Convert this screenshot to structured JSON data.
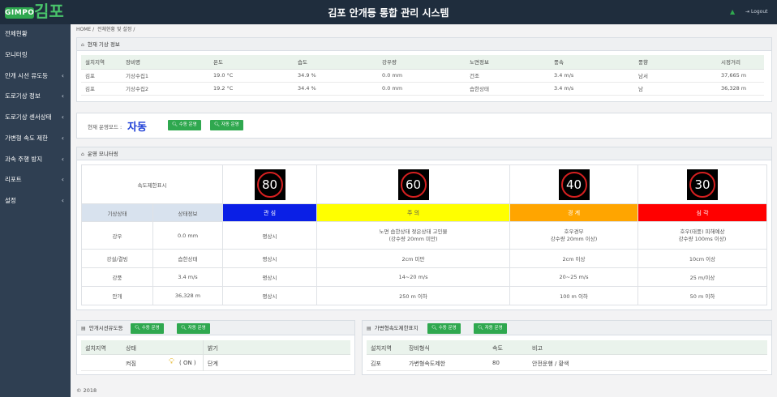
{
  "header": {
    "logo_en": "GIMPO",
    "logo_ko": "김포",
    "title": "김포 안개등 통합 관리 시스템",
    "logout_label": "Logout"
  },
  "sidebar": {
    "items": [
      {
        "label": "전체현황",
        "chevron": false
      },
      {
        "label": "모니터링",
        "chevron": false
      },
      {
        "label": "안개 시선 유도등",
        "chevron": true
      },
      {
        "label": "도로기상 정보",
        "chevron": true
      },
      {
        "label": "도로기상 센서상태",
        "chevron": true
      },
      {
        "label": "가변형 속도 제한",
        "chevron": true
      },
      {
        "label": "과속 주행 방지",
        "chevron": true
      },
      {
        "label": "리포트",
        "chevron": true
      },
      {
        "label": "설정",
        "chevron": true
      }
    ]
  },
  "breadcrumb": {
    "home": "HOME",
    "sep1": "/",
    "path": "전체현황 및 설정",
    "sep2": "/"
  },
  "weather": {
    "title": "현재 기상 정보",
    "columns": [
      "설치지역",
      "장비명",
      "온도",
      "습도",
      "강우량",
      "노면정보",
      "풍속",
      "풍향",
      "시정거리"
    ],
    "rows": [
      [
        "김포",
        "기상수집1",
        "19.0 °C",
        "34.9 %",
        "0.0 mm",
        "건조",
        "3.4 m/s",
        "남서",
        "37,665 m"
      ],
      [
        "김포",
        "기상수집2",
        "19.2 °C",
        "34.4 %",
        "0.0 mm",
        "습한상태",
        "3.4 m/s",
        "남",
        "36,328 m"
      ]
    ]
  },
  "mode": {
    "label": "현재 운영모드 :",
    "value": "자동",
    "manual_btn": "수동 운영",
    "auto_btn": "자동 운영"
  },
  "monitoring": {
    "title": "운영 모니터링",
    "speed_limit_label": "속도제한표시",
    "speeds": [
      "80",
      "60",
      "40",
      "30"
    ],
    "left_head": [
      "기상상태",
      "상태정보"
    ],
    "levels": [
      {
        "label": "관 심",
        "color": "#0a1fe6",
        "text_color": "#ffffff"
      },
      {
        "label": "주 의",
        "color": "#ffff00",
        "text_color": "#555555"
      },
      {
        "label": "경 계",
        "color": "#ffa500",
        "text_color": "#ffffff"
      },
      {
        "label": "심 각",
        "color": "#ff0000",
        "text_color": "#ffffff"
      }
    ],
    "rows": [
      {
        "name": "강우",
        "status": "0.0 mm",
        "cells": [
          "평상시",
          "노면 습한상태 젖은상태 고인물\n(강수량 20mm 미만)",
          "호우경부\n강수량 20mm 이상)",
          "호우(태풍) 피해예상\n강수량 100ms 이상)"
        ]
      },
      {
        "name": "강설/결빙",
        "status": "습한상태",
        "cells": [
          "평상시",
          "2cm 미만",
          "2cm 이상",
          "10cm 이상"
        ]
      },
      {
        "name": "강풍",
        "status": "3.4 m/s",
        "cells": [
          "평상시",
          "14~20 m/s",
          "20~25 m/s",
          "25 m/이상"
        ]
      },
      {
        "name": "안개",
        "status": "36,328 m",
        "cells": [
          "평상시",
          "250 m 이하",
          "100 m 이하",
          "50 m 이하"
        ]
      }
    ]
  },
  "fog_lights": {
    "title": "안개시선유도등",
    "manual_btn": "수동 운영",
    "auto_btn": "자동 운영",
    "columns": [
      "설치지역",
      "상태",
      "밝기"
    ],
    "row": {
      "region": "",
      "state": "켜짐",
      "on_text": "( ON )",
      "brightness": "단계"
    }
  },
  "speed_signs": {
    "title": "가변형속도제한표지",
    "manual_btn": "수동 운영",
    "auto_btn": "자동 운영",
    "columns": [
      "설치지역",
      "장비형식",
      "속도",
      "비고"
    ],
    "row": [
      "김포",
      "가변형속도제한",
      "80",
      "안전운행 / 황색"
    ]
  },
  "footer": {
    "copyright": "© 2018"
  }
}
